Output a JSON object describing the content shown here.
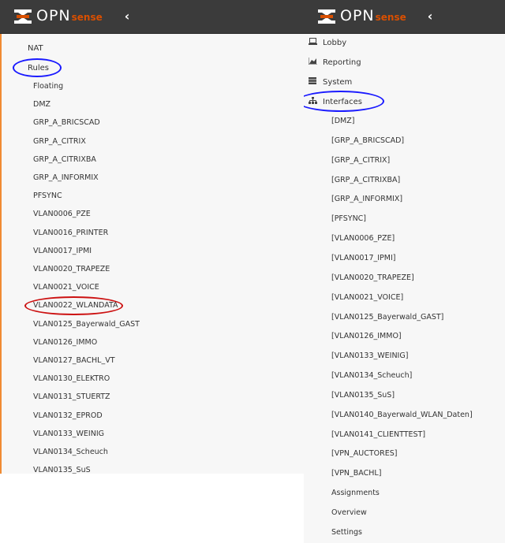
{
  "left_panel": {
    "brand": {
      "opn": "OPN",
      "sense": "sense"
    },
    "collapse_icon": "chevron-left-icon",
    "nat_label": "NAT",
    "rules_label": "Rules",
    "rules_items": [
      "Floating",
      "DMZ",
      "GRP_A_BRICSCAD",
      "GRP_A_CITRIX",
      "GRP_A_CITRIXBA",
      "GRP_A_INFORMIX",
      "PFSYNC",
      "VLAN0006_PZE",
      "VLAN0016_PRINTER",
      "VLAN0017_IPMI",
      "VLAN0020_TRAPEZE",
      "VLAN0021_VOICE",
      "VLAN0022_WLANDATA",
      "VLAN0125_Bayerwald_GAST",
      "VLAN0126_IMMO",
      "VLAN0127_BACHL_VT",
      "VLAN0130_ELEKTRO",
      "VLAN0131_STUERTZ",
      "VLAN0132_EPROD",
      "VLAN0133_WEINIG",
      "VLAN0134_Scheuch",
      "VLAN0135_SuS"
    ]
  },
  "right_panel": {
    "brand": {
      "opn": "OPN",
      "sense": "sense"
    },
    "collapse_icon": "chevron-left-icon",
    "top_items": [
      {
        "label": "Lobby",
        "icon": "laptop-icon"
      },
      {
        "label": "Reporting",
        "icon": "area-chart-icon"
      },
      {
        "label": "System",
        "icon": "server-icon"
      },
      {
        "label": "Interfaces",
        "icon": "sitemap-icon"
      }
    ],
    "interface_items": [
      "[DMZ]",
      "[GRP_A_BRICSCAD]",
      "[GRP_A_CITRIX]",
      "[GRP_A_CITRIXBA]",
      "[GRP_A_INFORMIX]",
      "[PFSYNC]",
      "[VLAN0006_PZE]",
      "[VLAN0017_IPMI]",
      "[VLAN0020_TRAPEZE]",
      "[VLAN0021_VOICE]",
      "[VLAN0125_Bayerwald_GAST]",
      "[VLAN0126_IMMO]",
      "[VLAN0133_WEINIG]",
      "[VLAN0134_Scheuch]",
      "[VLAN0135_SuS]",
      "[VLAN0140_Bayerwald_WLAN_Daten]",
      "[VLAN0141_CLIENTTEST]",
      "[VPN_AUCTORES]",
      "[VPN_BACHL]",
      "Assignments",
      "Overview",
      "Settings"
    ]
  },
  "annotation_colors": {
    "blue": "#1a1aff",
    "red": "#cc1111"
  },
  "brand_colors": {
    "orange": "#d94f00",
    "header": "#3b3b3b"
  }
}
